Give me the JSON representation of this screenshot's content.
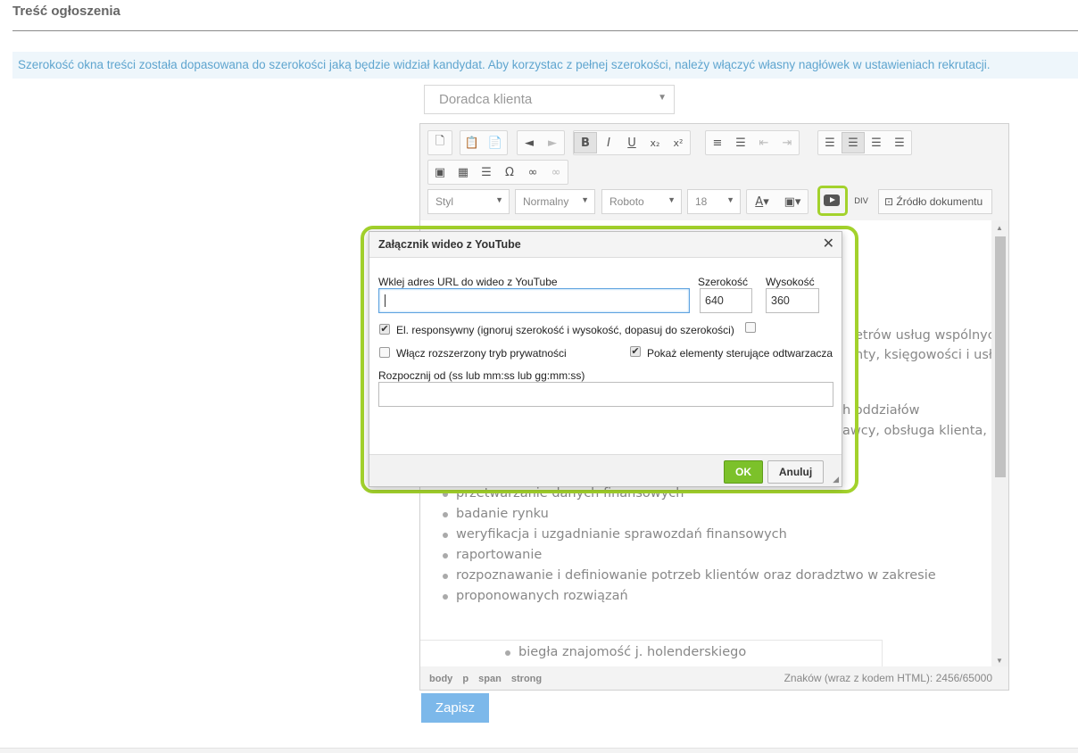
{
  "section": {
    "title": "Treść ogłoszenia"
  },
  "info": {
    "text": "Szerokość okna treści została dopasowana do szerokości jaką będzie widział kandydat. Aby korzystac z pełnej szerokości, należy włączyć własny nagłówek w ustawieniach rekrutacji."
  },
  "template_select": {
    "value": "Doradca klienta"
  },
  "toolbar": {
    "combos": {
      "style": "Styl",
      "format": "Normalny",
      "font": "Roboto",
      "size": "18"
    },
    "source_label": "Źródło dokumentu",
    "colors": {
      "highlight": "#a3d22c"
    },
    "icons": [
      "new-page-icon",
      "paste-text-icon",
      "paste-word-icon",
      "undo-icon",
      "redo-icon",
      "bold-icon",
      "italic-icon",
      "underline-icon",
      "subscript-icon",
      "superscript-icon",
      "numbered-list-icon",
      "bulleted-list-icon",
      "outdent-icon",
      "indent-icon",
      "align-left-icon",
      "align-center-icon",
      "align-right-icon",
      "justify-icon",
      "image-icon",
      "table-icon",
      "horizontal-line-icon",
      "special-char-icon",
      "link-icon",
      "unlink-icon",
      "text-color-icon",
      "bg-color-icon",
      "youtube-icon",
      "div-icon",
      "source-icon"
    ]
  },
  "content": {
    "frag1": "etrów usług wspólnych.",
    "frag2": "nty, księgowości i usług",
    "frag3": "h oddziałów",
    "frag4": "awcy, obsługa klienta,",
    "partial_item": "przetwarzanie danych finansowych",
    "list": [
      "badanie rynku",
      "weryfikacja i uzgadnianie sprawozdań finansowych",
      "raportowanie",
      "rozpoznawanie i definiowanie potrzeb klientów oraz doradztwo w zakresie",
      "proponowanych rozwiązań"
    ],
    "nested_item": "biegła znajomość j. holenderskiego"
  },
  "statusbar": {
    "path": [
      "body",
      "p",
      "span",
      "strong"
    ],
    "counter": "Znaków (wraz z kodem HTML): 2456/65000"
  },
  "save_label": "Zapisz",
  "dialog": {
    "title": "Załącznik wideo z YouTube",
    "close": "✕",
    "url_label": "Wklej adres URL do wideo z YouTube",
    "url_value": "",
    "width_label": "Szerokość",
    "width_value": "640",
    "height_label": "Wysokość",
    "height_value": "360",
    "responsive_label": "El. responsywny (ignoruj szerokość i wysokość, dopasuj do szerokości)",
    "responsive_checked": true,
    "privacy_label": "Włącz rozszerzony tryb prywatności",
    "privacy_checked": false,
    "controls_label": "Pokaż elementy sterujące odtwarzacza",
    "controls_checked": true,
    "start_label": "Rozpocznij od (ss lub mm:ss lub gg:mm:ss)",
    "start_value": "",
    "ok_label": "OK",
    "cancel_label": "Anuluj"
  }
}
